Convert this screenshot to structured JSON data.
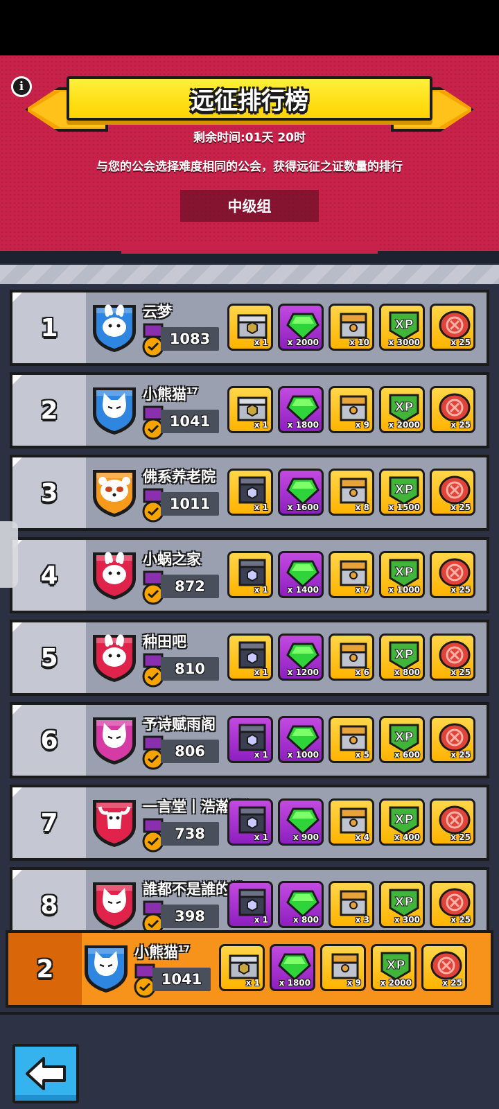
{
  "header": {
    "title": "远征排行榜",
    "time_left": "剩余时间:01天 20时",
    "description": "与您的公会选择难度相同的公会，获得远征之证数量的排行",
    "group": "中级组",
    "info_glyph": "i"
  },
  "colors": {
    "header_bg": "#c8224a",
    "title_banner": "#ffd400",
    "row_bg": "#9aa0b0",
    "my_row_bg": "#f7931b",
    "shield_blue": "#2f86e0",
    "shield_orange": "#f59a1a",
    "shield_red": "#e0234a",
    "shield_magenta": "#d63aa4",
    "reward_gold": "#ffc21a",
    "reward_purple": "#a42fd4"
  },
  "rows": [
    {
      "rank": "1",
      "name": "云梦",
      "sup": "",
      "score": "1083",
      "shield": "blue",
      "emblem": "rabbit",
      "rewards": [
        {
          "type": "gold",
          "icon": "chest-silver-icon",
          "qty": "x 1"
        },
        {
          "type": "purple",
          "icon": "gem-icon",
          "qty": "x 2000"
        },
        {
          "type": "gold",
          "icon": "chest-bronze-icon",
          "qty": "x 10"
        },
        {
          "type": "gold",
          "icon": "xp-icon",
          "qty": "x 3000"
        },
        {
          "type": "gold",
          "icon": "badge-token-icon",
          "qty": "x 25"
        }
      ]
    },
    {
      "rank": "2",
      "name": "小熊猫",
      "sup": "17",
      "score": "1041",
      "shield": "blue",
      "emblem": "cat",
      "rewards": [
        {
          "type": "gold",
          "icon": "chest-silver-icon",
          "qty": "x 1"
        },
        {
          "type": "purple",
          "icon": "gem-icon",
          "qty": "x 1800"
        },
        {
          "type": "gold",
          "icon": "chest-bronze-icon",
          "qty": "x 9"
        },
        {
          "type": "gold",
          "icon": "xp-icon",
          "qty": "x 2000"
        },
        {
          "type": "gold",
          "icon": "badge-token-icon",
          "qty": "x 25"
        }
      ]
    },
    {
      "rank": "3",
      "name": "佛系养老院",
      "sup": "",
      "score": "1011",
      "shield": "orange",
      "emblem": "panda",
      "rewards": [
        {
          "type": "gold",
          "icon": "chest-dark-icon",
          "qty": "x 1"
        },
        {
          "type": "purple",
          "icon": "gem-icon",
          "qty": "x 1600"
        },
        {
          "type": "gold",
          "icon": "chest-bronze-icon",
          "qty": "x 8"
        },
        {
          "type": "gold",
          "icon": "xp-icon",
          "qty": "x 1500"
        },
        {
          "type": "gold",
          "icon": "badge-token-icon",
          "qty": "x 25"
        }
      ]
    },
    {
      "rank": "4",
      "name": "小蜗之家",
      "sup": "",
      "score": "872",
      "shield": "red",
      "emblem": "rabbit",
      "rewards": [
        {
          "type": "gold",
          "icon": "chest-dark-icon",
          "qty": "x 1"
        },
        {
          "type": "purple",
          "icon": "gem-icon",
          "qty": "x 1400"
        },
        {
          "type": "gold",
          "icon": "chest-bronze-icon",
          "qty": "x 7"
        },
        {
          "type": "gold",
          "icon": "xp-icon",
          "qty": "x 1000"
        },
        {
          "type": "gold",
          "icon": "badge-token-icon",
          "qty": "x 25"
        }
      ]
    },
    {
      "rank": "5",
      "name": "种田吧",
      "sup": "",
      "score": "810",
      "shield": "red",
      "emblem": "rabbit",
      "rewards": [
        {
          "type": "gold",
          "icon": "chest-dark-icon",
          "qty": "x 1"
        },
        {
          "type": "purple",
          "icon": "gem-icon",
          "qty": "x 1200"
        },
        {
          "type": "gold",
          "icon": "chest-bronze-icon",
          "qty": "x 6"
        },
        {
          "type": "gold",
          "icon": "xp-icon",
          "qty": "x 800"
        },
        {
          "type": "gold",
          "icon": "badge-token-icon",
          "qty": "x 25"
        }
      ]
    },
    {
      "rank": "6",
      "name": "予诗赋雨阁",
      "sup": "",
      "score": "806",
      "shield": "magenta",
      "emblem": "cat",
      "rewards": [
        {
          "type": "purple",
          "icon": "chest-dark-icon",
          "qty": "x 1"
        },
        {
          "type": "purple",
          "icon": "gem-icon",
          "qty": "x 1000"
        },
        {
          "type": "gold",
          "icon": "chest-bronze-icon",
          "qty": "x 5"
        },
        {
          "type": "gold",
          "icon": "xp-icon",
          "qty": "x 600"
        },
        {
          "type": "gold",
          "icon": "badge-token-icon",
          "qty": "x 25"
        }
      ]
    },
    {
      "rank": "7",
      "name": "一言堂丨浩瀚星河",
      "sup": "",
      "score": "738",
      "shield": "red",
      "emblem": "bull",
      "rewards": [
        {
          "type": "purple",
          "icon": "chest-dark-icon",
          "qty": "x 1"
        },
        {
          "type": "purple",
          "icon": "gem-icon",
          "qty": "x 900"
        },
        {
          "type": "gold",
          "icon": "chest-bronze-icon",
          "qty": "x 4"
        },
        {
          "type": "gold",
          "icon": "xp-icon",
          "qty": "x 400"
        },
        {
          "type": "gold",
          "icon": "badge-token-icon",
          "qty": "x 25"
        }
      ]
    },
    {
      "rank": "8",
      "name": "誰都不是誰的誰",
      "sup": "",
      "score": "398",
      "shield": "red",
      "emblem": "cat",
      "rewards": [
        {
          "type": "purple",
          "icon": "chest-dark-icon",
          "qty": "x 1"
        },
        {
          "type": "purple",
          "icon": "gem-icon",
          "qty": "x 800"
        },
        {
          "type": "gold",
          "icon": "chest-bronze-icon",
          "qty": "x 3"
        },
        {
          "type": "gold",
          "icon": "xp-icon",
          "qty": "x 300"
        },
        {
          "type": "gold",
          "icon": "badge-token-icon",
          "qty": "x 25"
        }
      ]
    }
  ],
  "my_row": {
    "rank": "2",
    "name": "小熊猫",
    "sup": "17",
    "score": "1041",
    "shield": "blue",
    "emblem": "cat",
    "rewards": [
      {
        "type": "gold",
        "icon": "chest-silver-icon",
        "qty": "x 1"
      },
      {
        "type": "purple",
        "icon": "gem-icon",
        "qty": "x 1800"
      },
      {
        "type": "gold",
        "icon": "chest-bronze-icon",
        "qty": "x 9"
      },
      {
        "type": "gold",
        "icon": "xp-icon",
        "qty": "x 2000"
      },
      {
        "type": "gold",
        "icon": "badge-token-icon",
        "qty": "x 25"
      }
    ]
  },
  "xp_label": "XP",
  "back_icon": "back-arrow-icon"
}
